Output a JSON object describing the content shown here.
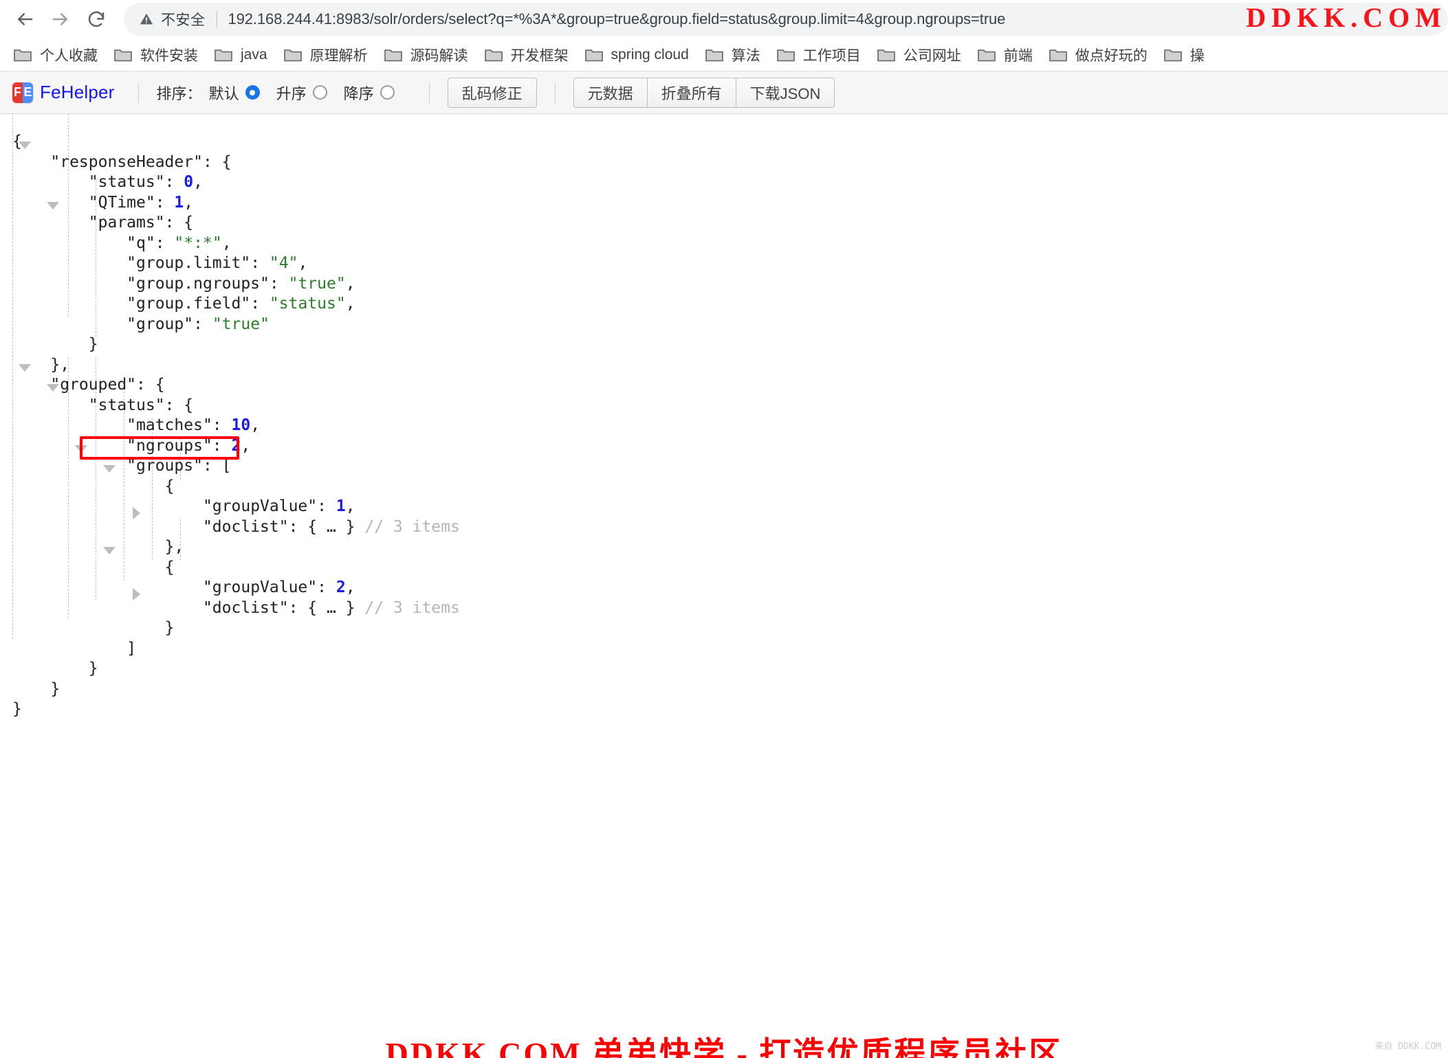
{
  "browser": {
    "back_icon": "arrow-left-icon",
    "forward_icon": "arrow-right-icon",
    "reload_icon": "reload-icon",
    "warning_icon": "warning-triangle-icon",
    "insecure_label": "不安全",
    "url_host": "192.168.244.41:8983",
    "url_path": "/solr/orders/select",
    "url_query": "?q=*%3A*&group=true&group.field=status&group.limit=4&group.ngroups=true",
    "url_full": "192.168.244.41:8983/solr/orders/select?q=*%3A*&group=true&group.field=status&group.limit=4&group.ngroups=true",
    "watermark_top": "DDKK.COM"
  },
  "bookmarks": [
    {
      "icon": "folder-icon",
      "label": "个人收藏"
    },
    {
      "icon": "folder-icon",
      "label": "软件安装"
    },
    {
      "icon": "folder-icon",
      "label": "java"
    },
    {
      "icon": "folder-icon",
      "label": "原理解析"
    },
    {
      "icon": "folder-icon",
      "label": "源码解读"
    },
    {
      "icon": "folder-icon",
      "label": "开发框架"
    },
    {
      "icon": "folder-icon",
      "label": "spring cloud"
    },
    {
      "icon": "folder-icon",
      "label": "算法"
    },
    {
      "icon": "folder-icon",
      "label": "工作项目"
    },
    {
      "icon": "folder-icon",
      "label": "公司网址"
    },
    {
      "icon": "folder-icon",
      "label": "前端"
    },
    {
      "icon": "folder-icon",
      "label": "做点好玩的"
    },
    {
      "icon": "folder-icon",
      "label": "操"
    }
  ],
  "toolbar": {
    "app_name": "FeHelper",
    "logo_f": "F",
    "logo_e": "E",
    "sort_label": "排序：",
    "sort_options": [
      {
        "label": "默认",
        "checked": true
      },
      {
        "label": "升序",
        "checked": false
      },
      {
        "label": "降序",
        "checked": false
      }
    ],
    "fix_encoding_button": "乱码修正",
    "metadata_button": "元数据",
    "collapse_all_button": "折叠所有",
    "download_json_button": "下载JSON"
  },
  "json_lines": [
    {
      "id": "l0",
      "indent": 0,
      "text": "{"
    },
    {
      "id": "l1",
      "indent": 1,
      "text": "\"responseHeader\": {"
    },
    {
      "id": "l2",
      "indent": 2,
      "text": "\"status\": 0,"
    },
    {
      "id": "l3",
      "indent": 2,
      "text": "\"QTime\": 1,"
    },
    {
      "id": "l4",
      "indent": 2,
      "text": "\"params\": {"
    },
    {
      "id": "l5",
      "indent": 3,
      "text": "\"q\": \"*:*\","
    },
    {
      "id": "l6",
      "indent": 3,
      "text": "\"group.limit\": \"4\","
    },
    {
      "id": "l7",
      "indent": 3,
      "text": "\"group.ngroups\": \"true\","
    },
    {
      "id": "l8",
      "indent": 3,
      "text": "\"group.field\": \"status\","
    },
    {
      "id": "l9",
      "indent": 3,
      "text": "\"group\": \"true\""
    },
    {
      "id": "l10",
      "indent": 2,
      "text": "}"
    },
    {
      "id": "l11",
      "indent": 1,
      "text": "},"
    },
    {
      "id": "l12",
      "indent": 1,
      "text": "\"grouped\": {"
    },
    {
      "id": "l13",
      "indent": 2,
      "text": "\"status\": {"
    },
    {
      "id": "l14",
      "indent": 3,
      "text": "\"matches\": 10,"
    },
    {
      "id": "l15",
      "indent": 3,
      "text": "\"ngroups\": 2,"
    },
    {
      "id": "l16",
      "indent": 3,
      "text": "\"groups\": ["
    },
    {
      "id": "l17",
      "indent": 4,
      "text": "{"
    },
    {
      "id": "l18",
      "indent": 5,
      "text": "\"groupValue\": 1,"
    },
    {
      "id": "l19",
      "indent": 5,
      "text": "\"doclist\": { … } // 3 items"
    },
    {
      "id": "l20",
      "indent": 4,
      "text": "},"
    },
    {
      "id": "l21",
      "indent": 4,
      "text": "{"
    },
    {
      "id": "l22",
      "indent": 5,
      "text": "\"groupValue\": 2,"
    },
    {
      "id": "l23",
      "indent": 5,
      "text": "\"doclist\": { … } // 3 items"
    },
    {
      "id": "l24",
      "indent": 4,
      "text": "}"
    },
    {
      "id": "l25",
      "indent": 3,
      "text": "]"
    },
    {
      "id": "l26",
      "indent": 2,
      "text": "}"
    },
    {
      "id": "l27",
      "indent": 1,
      "text": "}"
    },
    {
      "id": "l28",
      "indent": 0,
      "text": "}"
    }
  ],
  "json_values": {
    "responseHeader_status": 0,
    "responseHeader_QTime": 1,
    "params_q": "*:*",
    "params_group_limit": "4",
    "params_group_ngroups": "true",
    "params_group_field": "status",
    "params_group": "true",
    "grouped_status_matches": 10,
    "grouped_status_ngroups": 2,
    "group0_groupValue": 1,
    "group0_doclist_items": "3 items",
    "group1_groupValue": 2,
    "group1_doclist_items": "3 items"
  },
  "annotation": {
    "highlight_target": "\"ngroups\": 2,",
    "highlight_color": "#ff0000"
  },
  "footer": {
    "watermark": "DDKK.COM 弟弟快学 - 打造优质程序员社区",
    "watermark_color": "#ff0000",
    "watermark_sub": "来自 DDKK.COM"
  }
}
